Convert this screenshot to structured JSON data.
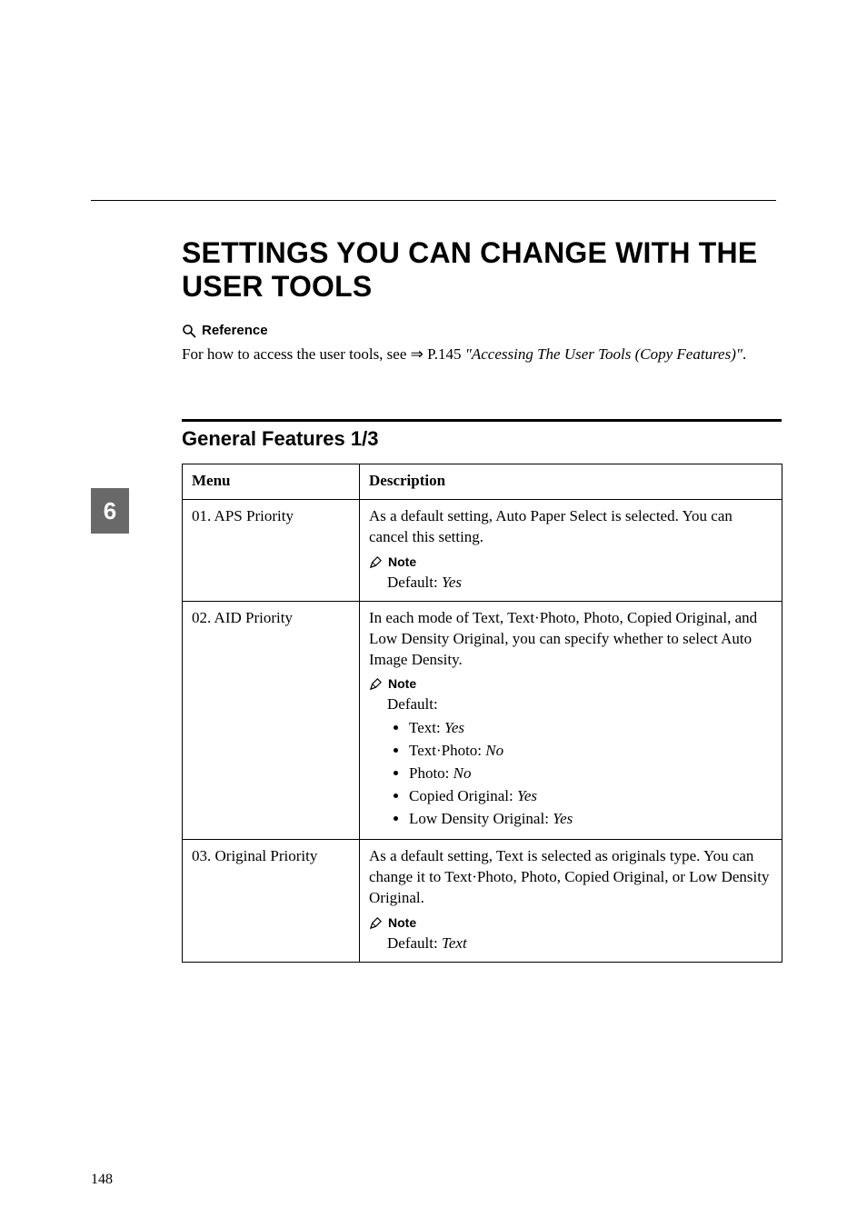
{
  "page": {
    "number": "148",
    "side_tab": "6"
  },
  "heading": "SETTINGS YOU CAN CHANGE WITH THE USER TOOLS",
  "reference": {
    "label": "Reference",
    "text_pre": "For how to access the user tools, see ",
    "arrow": "⇒",
    "text_mid": " P.145 ",
    "italic": "\"Accessing The User Tools (Copy Features)\"",
    "text_post": "."
  },
  "section_title": "General Features 1/3",
  "table": {
    "head": {
      "menu": "Menu",
      "desc": "Description"
    },
    "rows": [
      {
        "menu": "01. APS Priority",
        "desc_main": "As a default setting, Auto Paper Select is selected. You can cancel this setting.",
        "note_label": "Note",
        "note_lines": [
          "Default: Yes"
        ],
        "note_bullets": []
      },
      {
        "menu": "02. AID Priority",
        "desc_main": "In each mode of Text, Text·Photo, Photo, Copied Original, and Low Density Original, you can specify whether to select Auto Image Density.",
        "note_label": "Note",
        "note_lines": [
          "Default:"
        ],
        "note_bullets": [
          {
            "pre": "Text: ",
            "ital": "Yes"
          },
          {
            "pre": "Text·Photo: ",
            "ital": "No"
          },
          {
            "pre": "Photo: ",
            "ital": "No"
          },
          {
            "pre": "Copied Original: ",
            "ital": "Yes"
          },
          {
            "pre": "Low Density Original: ",
            "ital": "Yes"
          }
        ]
      },
      {
        "menu": "03. Original Priority",
        "desc_main": "As a default setting, Text is selected as originals type. You can change it to Text·Photo, Photo, Copied Original, or Low Density Original.",
        "note_label": "Note",
        "note_lines": [
          "Default: Text"
        ],
        "note_bullets": []
      }
    ]
  }
}
